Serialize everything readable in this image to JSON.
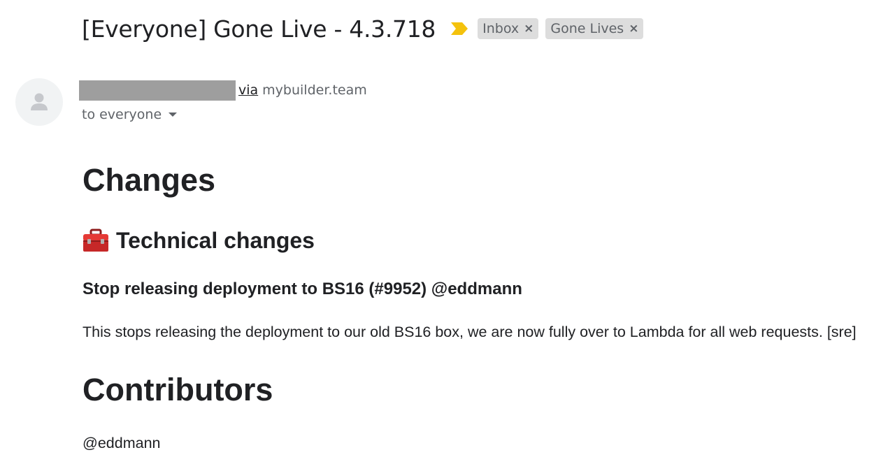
{
  "email": {
    "subject": "[Everyone] Gone Live - 4.3.718",
    "importance_icon": "importance-marker-icon",
    "importance_color": "#f4c20d",
    "labels": [
      {
        "name": "Inbox",
        "remove_icon": "×"
      },
      {
        "name": "Gone Lives",
        "remove_icon": "×"
      }
    ],
    "sender": {
      "avatar_icon": "person-icon",
      "name_redacted": true,
      "via_label": "via",
      "domain": "mybuilder.team"
    },
    "recipients": {
      "label": "to everyone",
      "dropdown_icon": "caret-down-icon"
    }
  },
  "message": {
    "heading_changes": "Changes",
    "section_icon": "toolbox-icon",
    "heading_technical": "Technical changes",
    "change_title": "Stop releasing deployment to BS16 (#9952) @eddmann",
    "change_description": "This stops releasing the deployment to our old BS16 box, we are now fully over to Lambda for all web requests. [sre]",
    "heading_contributors": "Contributors",
    "contributors": "@eddmann"
  }
}
